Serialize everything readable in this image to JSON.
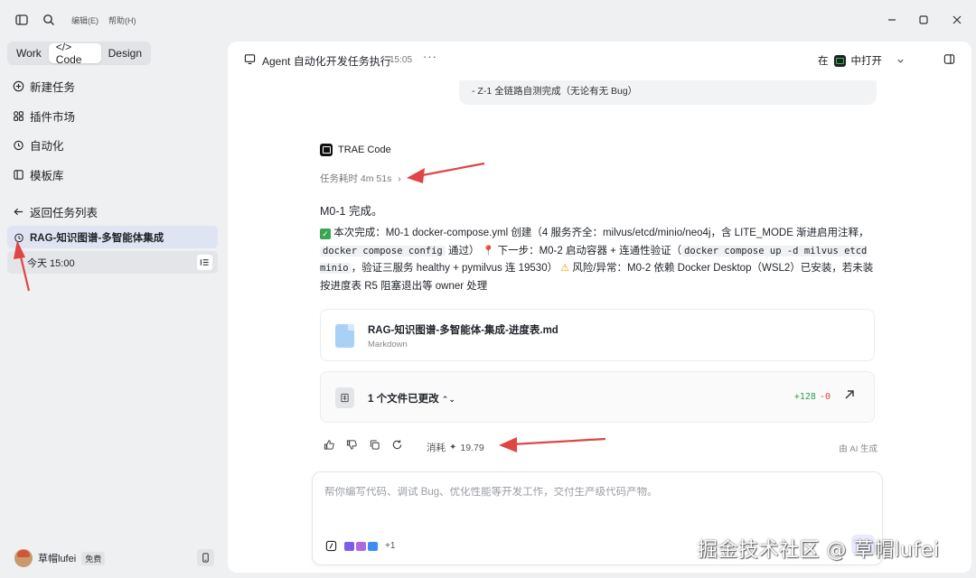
{
  "menu": {
    "edit": "编辑(E)",
    "help": "帮助(H)"
  },
  "modes": [
    {
      "label": "Work",
      "active": false
    },
    {
      "label": "</> Code",
      "active": true
    },
    {
      "label": "Design",
      "active": false
    }
  ],
  "sidebar": {
    "items": [
      {
        "label": "新建任务",
        "icon": "plus-circle-icon"
      },
      {
        "label": "插件市场",
        "icon": "plugin-grid-icon"
      },
      {
        "label": "自动化",
        "icon": "alarm-clock-icon"
      },
      {
        "label": "模板库",
        "icon": "template-icon"
      }
    ],
    "back_label": "返回任务列表",
    "active_task": "RAG-知识图谱-多智能体集成",
    "task_time": "今天 15:00",
    "user_name": "草帽lufei",
    "user_badge": "免费"
  },
  "header": {
    "title": "Agent 自动化开发任务执行",
    "time": "15:05",
    "open_prefix": "在",
    "open_label": "中打开"
  },
  "chat": {
    "previous_snippet": "- Z-1 全链路自测完成（无论有无 Bug）",
    "agent_name": "TRAE Code",
    "duration": "任务耗时 4m 51s",
    "title": "M0-1 完成。",
    "body_1": " 本次完成：M0-1 docker-compose.yml 创建（4 服务齐全：milvus/etcd/minio/neo4j，含 LITE_MODE 渐进启用注释，",
    "code_1": "docker compose config",
    "body_2": " 通过）",
    "body_3": " 下一步：M0-2 启动容器 + 连通性验证（",
    "code_2": "docker compose up -d milvus etcd minio",
    "body_4": "，验证三服务 healthy + pymilvus 连 19530）",
    "body_5": " 风险/异常：M0-2 依赖 Docker Desktop（WSL2）已安装，若未装按进度表 R5 阻塞退出等 owner 处理",
    "file_name": "RAG-知识图谱-多智能体-集成-进度表.md",
    "file_type": "Markdown",
    "changes_label": "1 个文件已更改",
    "diff_plus": "+128",
    "diff_minus": "-0",
    "cost_label": "消耗",
    "cost_value": "19.79",
    "ai_generated": "由 AI 生成"
  },
  "composer": {
    "placeholder": "帮你编写代码、调试 Bug、优化性能等开发工作，交付生产级代码产物。",
    "extra_models": "+1"
  },
  "watermark": "掘金技术社区 @ 草帽lufei"
}
